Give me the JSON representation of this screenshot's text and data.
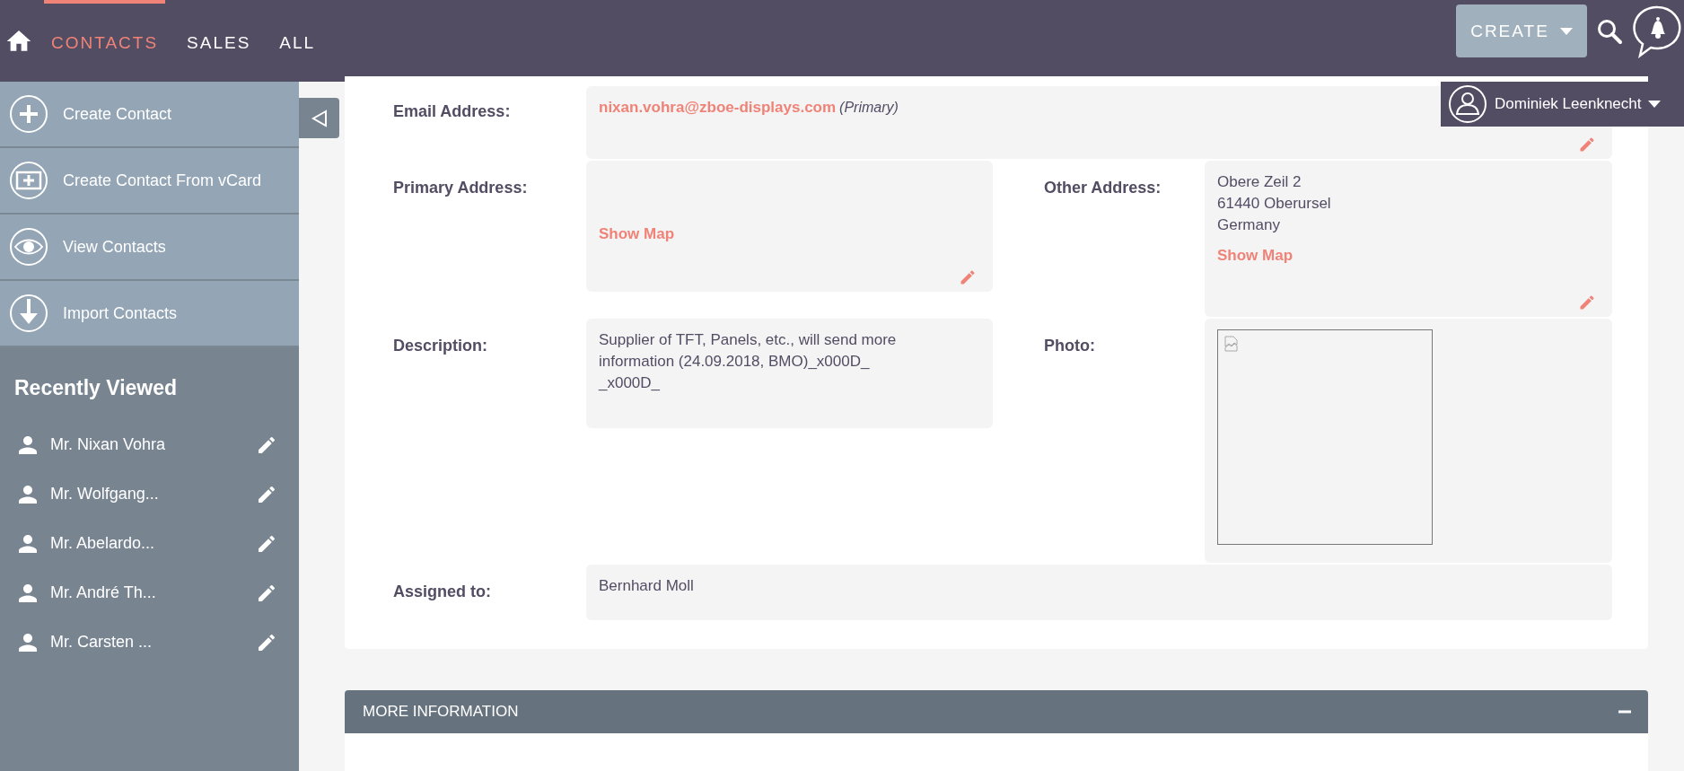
{
  "nav": {
    "tabs": [
      {
        "label": "CONTACTS",
        "selected": true
      },
      {
        "label": "SALES",
        "selected": false
      },
      {
        "label": "ALL",
        "selected": false
      }
    ],
    "create": "CREATE",
    "user": "Dominiek Leenknecht"
  },
  "sidebar": {
    "actions": [
      {
        "label": "Create Contact",
        "kind": "plus"
      },
      {
        "label": "Create Contact From vCard",
        "kind": "vcard"
      },
      {
        "label": "View Contacts",
        "kind": "eye"
      },
      {
        "label": "Import Contacts",
        "kind": "download"
      }
    ],
    "recently_viewed": {
      "title": "Recently Viewed",
      "items": [
        "Mr. Nixan Vohra",
        "Mr. Wolfgang...",
        "Mr. Abelardo...",
        "Mr. André Th...",
        "Mr. Carsten ..."
      ]
    }
  },
  "detail": {
    "rows": [
      [
        {
          "kind": "email",
          "label": "Email Address:",
          "value": "nixan.vohra@zboe-displays.com",
          "note": "(Primary)",
          "editable": true
        }
      ],
      [
        {
          "kind": "address",
          "label": "Primary Address:",
          "link": "Show Map",
          "editable": true
        },
        {
          "kind": "address",
          "label": "Other Address:",
          "lines": [
            "Obere Zeil 2",
            "61440 Oberursel",
            "Germany"
          ],
          "link": "Show Map",
          "editable": true
        }
      ],
      [
        {
          "kind": "text",
          "label": "Description:",
          "lines": [
            "Supplier of TFT, Panels, etc., will send more",
            "information (24.09.2018, BMO)_x000D_",
            "_x000D_"
          ],
          "editable": false
        },
        {
          "kind": "photo",
          "label": "Photo:",
          "editable": false
        }
      ],
      [
        {
          "kind": "text",
          "label": "Assigned to:",
          "lines": [
            "Bernhard Moll"
          ],
          "editable": false
        }
      ]
    ]
  },
  "panel": {
    "title": "MORE INFORMATION",
    "expanded": true
  }
}
